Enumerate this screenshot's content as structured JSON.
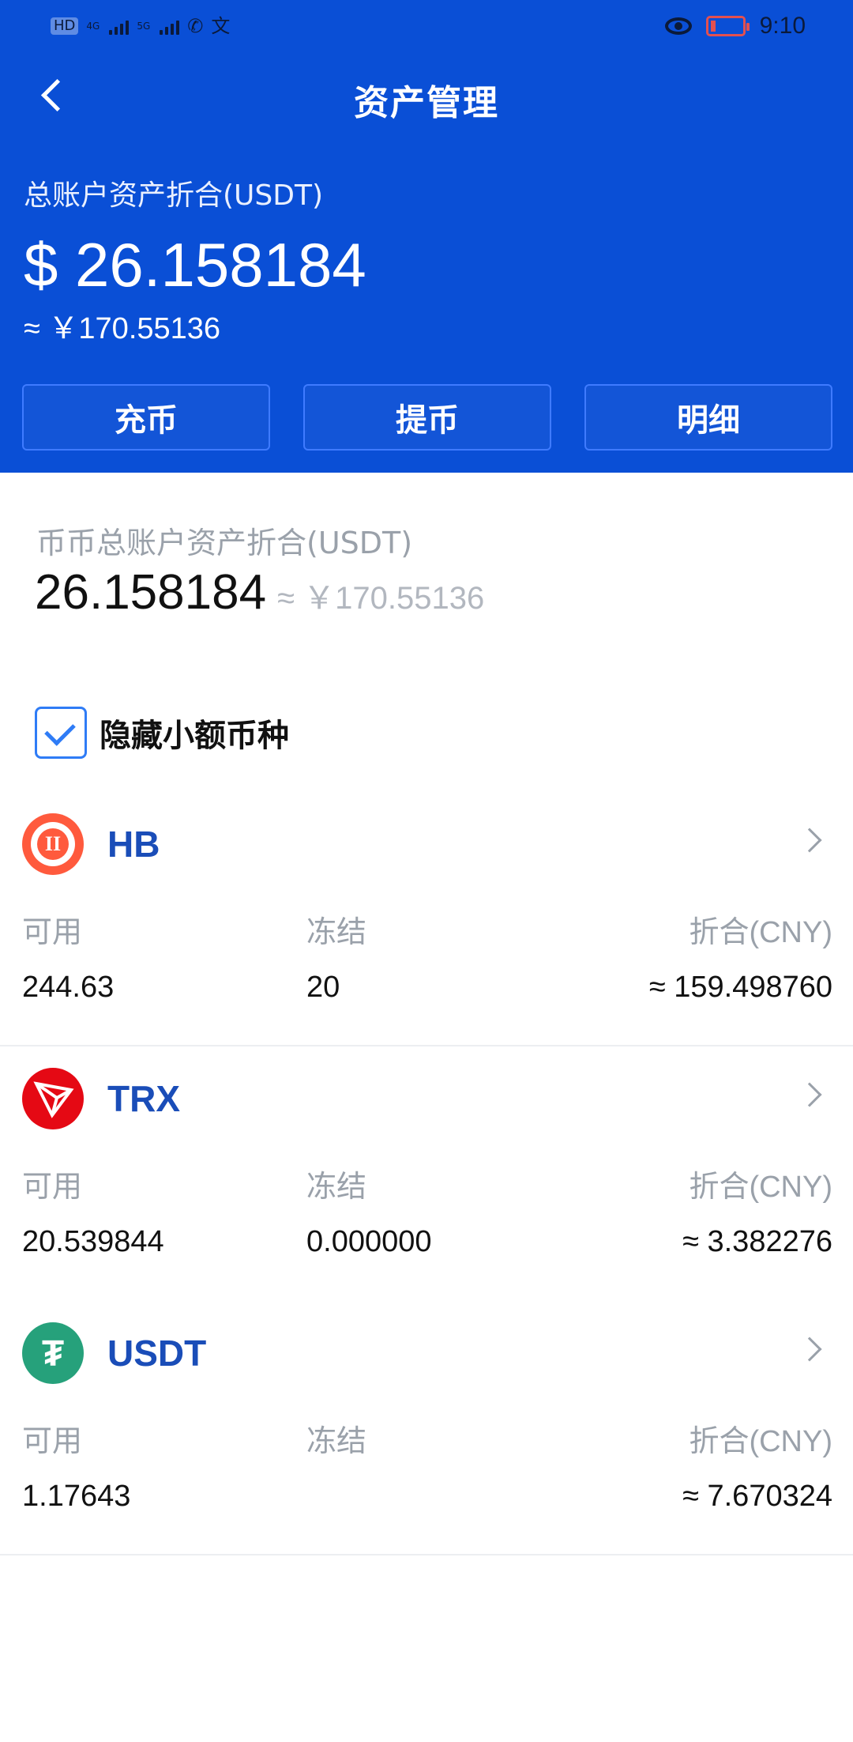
{
  "status_bar": {
    "left": {
      "hd": "HD",
      "network1": "4G",
      "network2": "5G",
      "extra_icons": [
        "phone-call-icon",
        "translate-icon"
      ]
    },
    "time": "9:10"
  },
  "nav": {
    "title": "资产管理"
  },
  "overview": {
    "label": "总账户资产折合(USDT)",
    "usd_value": "$ 26.158184",
    "cny_value": "≈ ￥170.55136"
  },
  "actions": {
    "deposit": "充币",
    "withdraw": "提币",
    "details": "明细"
  },
  "spot": {
    "label": "币币总账户资产折合(USDT)",
    "value": "26.158184",
    "cny_value": "≈ ￥170.55136"
  },
  "filter": {
    "hide_small_label": "隐藏小额币种",
    "checked": true
  },
  "coins": [
    {
      "symbol": "HB",
      "labels": {
        "available": "可用",
        "frozen": "冻结",
        "equivalent": "折合(CNY)"
      },
      "values": {
        "available": "244.63",
        "frozen": "20",
        "equivalent": "≈ 159.498760"
      }
    },
    {
      "symbol": "TRX",
      "labels": {
        "available": "可用",
        "frozen": "冻结",
        "equivalent": "折合(CNY)"
      },
      "values": {
        "available": "20.539844",
        "frozen": "0.000000",
        "equivalent": "≈ 3.382276"
      }
    },
    {
      "symbol": "USDT",
      "labels": {
        "available": "可用",
        "frozen": "冻结",
        "equivalent": "折合(CNY)"
      },
      "values": {
        "available": "1.17643",
        "frozen": "",
        "equivalent": "≈ 7.670324"
      }
    }
  ],
  "colors": {
    "header_blue": "#0a4fd6",
    "link_blue": "#1a4db8",
    "muted_gray": "#9aa1aa",
    "hb_red": "#ff5a3d",
    "trx_red": "#e50914",
    "usdt_green": "#26a17b"
  }
}
